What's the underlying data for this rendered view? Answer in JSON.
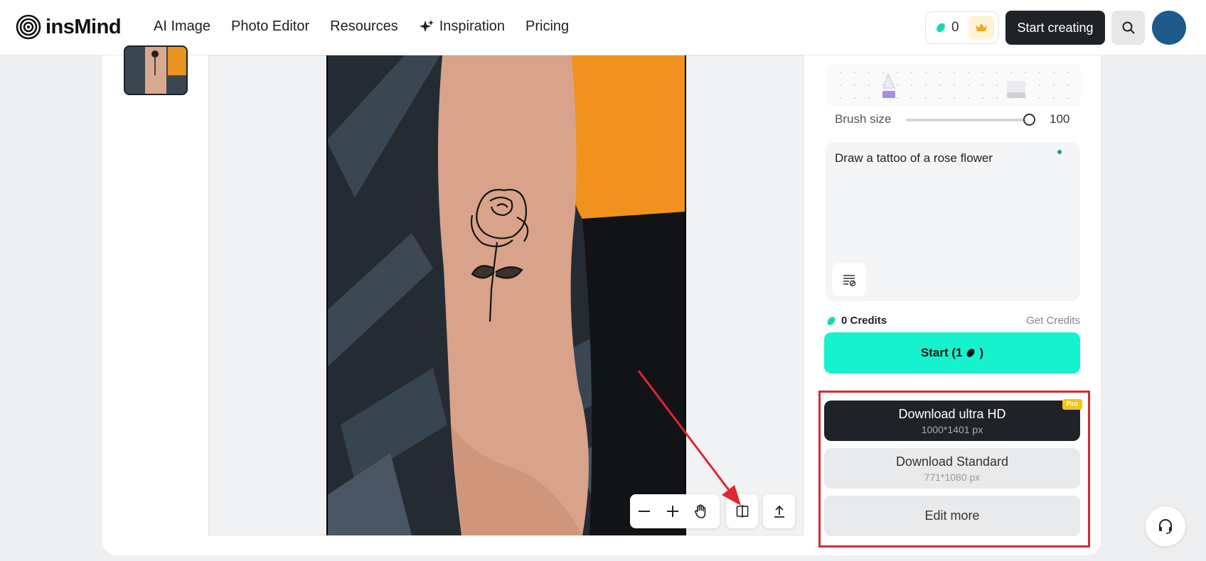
{
  "header": {
    "logo_text": "insMind",
    "nav": [
      "AI Image",
      "Photo Editor",
      "Resources",
      "Inspiration",
      "Pricing"
    ],
    "credits_count": "0",
    "start_creating": "Start creating"
  },
  "panel": {
    "brush_label": "Brush size",
    "brush_value": "100",
    "prompt_text": "Draw a tattoo of a rose flower",
    "credits_label": "0 Credits",
    "get_credits": "Get Credits",
    "start_label": "Start (1",
    "start_suffix": ")",
    "download_hd": "Download ultra HD",
    "download_hd_size": "1000*1401 px",
    "pro_badge": "Pro",
    "download_standard": "Download Standard",
    "download_standard_size": "771*1080 px",
    "edit_more": "Edit more"
  },
  "colors": {
    "accent_teal": "#16f2cd",
    "dark_button": "#1f2226",
    "highlight_red": "#d42a37",
    "pro_yellow": "#f5c518"
  },
  "icons": [
    "logo-icon",
    "sparkle-icon",
    "credit-bean-icon",
    "crown-icon",
    "search-icon",
    "zoom-out-icon",
    "zoom-in-icon",
    "hand-icon",
    "compare-icon",
    "upload-icon",
    "prompt-clear-icon",
    "headset-icon"
  ]
}
